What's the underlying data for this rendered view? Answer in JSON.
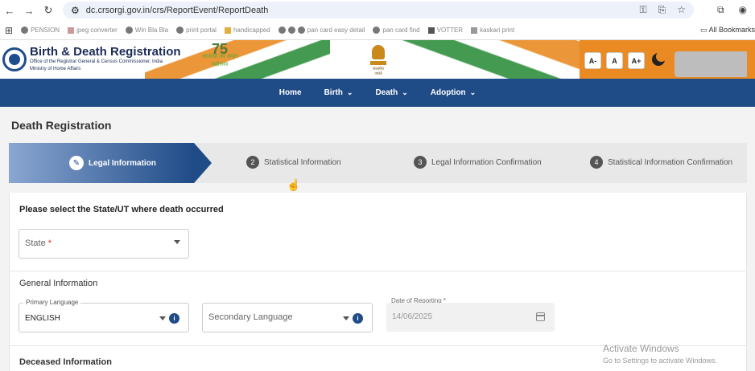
{
  "browser": {
    "url": "dc.crsorgi.gov.in/crs/ReportEvent/ReportDeath",
    "bookmarks": [
      "PENSION",
      "jpeg converter",
      "Win Bla Bla",
      "print portal",
      "handicapped",
      "pan card easy detail",
      "pan card find",
      "VOTTER",
      "kaskari print"
    ],
    "bookmarks_all": "All Bookmarks"
  },
  "site": {
    "title": "Birth & Death Registration",
    "subtitle1": "Office of the Registrar General & Census Commissioner, India",
    "subtitle2": "Ministry of Home Affairs",
    "amrit_num": "75",
    "amrit_text": "आज़ादी का अमृत महोत्सव",
    "emblem_text": "सत्यमेव जयते",
    "font_small": "A-",
    "font_normal": "A",
    "font_large": "A+"
  },
  "nav": {
    "home": "Home",
    "birth": "Birth",
    "death": "Death",
    "adoption": "Adoption"
  },
  "page": {
    "title": "Death Registration"
  },
  "stepper": {
    "steps": [
      {
        "num": "1",
        "label": "Legal Information"
      },
      {
        "num": "2",
        "label": "Statistical Information"
      },
      {
        "num": "3",
        "label": "Legal Information Confirmation"
      },
      {
        "num": "4",
        "label": "Statistical Information Confirmation"
      }
    ]
  },
  "form": {
    "state_question": "Please select the State/UT where death occurred",
    "state_placeholder": "State",
    "required_mark": "*",
    "general_heading": "General Information",
    "primary_language_label": "Primary Language",
    "primary_language_value": "ENGLISH",
    "secondary_language_placeholder": "Secondary Language",
    "date_label": "Date of Reporting *",
    "date_value": "14/06/2025",
    "deceased_heading": "Deceased Information",
    "info_glyph": "i"
  },
  "watermark": {
    "line1": "Activate Windows",
    "line2": "Go to Settings to activate Windows."
  }
}
